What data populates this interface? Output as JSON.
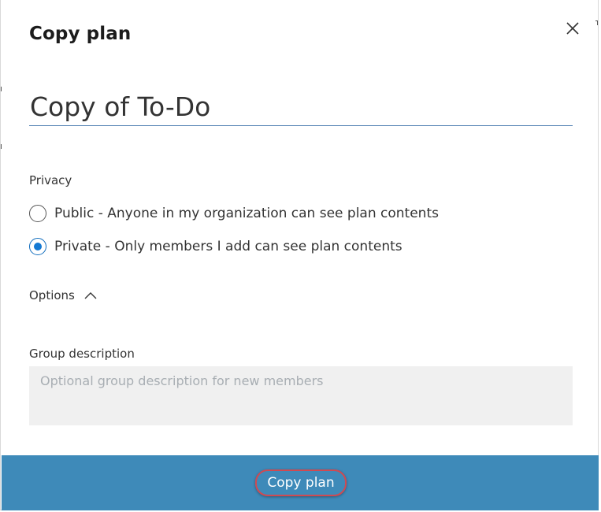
{
  "dialog": {
    "title": "Copy plan",
    "close_icon": "close-icon"
  },
  "plan_name": {
    "value": "Copy of To-Do"
  },
  "privacy": {
    "label": "Privacy",
    "options": [
      {
        "label": "Public - Anyone in my organization can see plan contents",
        "selected": false
      },
      {
        "label": "Private - Only members I add can see plan contents",
        "selected": true
      }
    ]
  },
  "options": {
    "label": "Options",
    "expanded": true,
    "chevron_icon": "chevron-up-icon"
  },
  "group_description": {
    "label": "Group description",
    "placeholder": "Optional group description for new members",
    "value": ""
  },
  "footer": {
    "button_label": "Copy plan"
  },
  "colors": {
    "footer_bg": "#3e8ab9",
    "radio_selected": "#1479d3",
    "highlight_ring": "#cf4a52",
    "input_underline": "#5a87b6",
    "textarea_bg": "#f0f0f0"
  }
}
